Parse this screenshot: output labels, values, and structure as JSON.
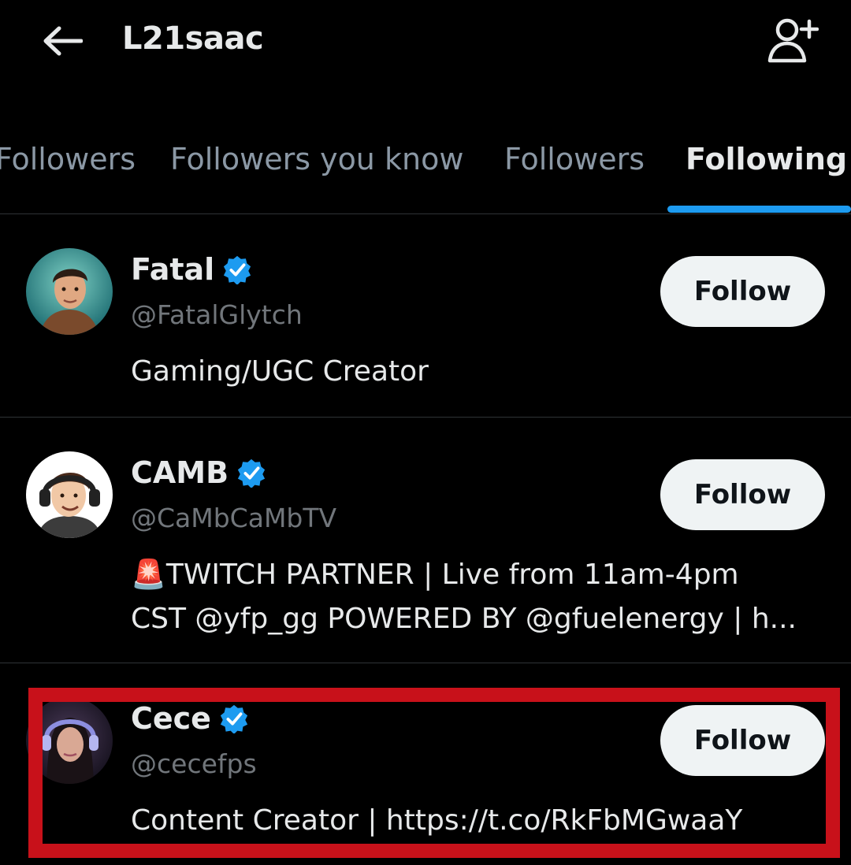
{
  "header": {
    "title": "L21saac"
  },
  "tabs": [
    {
      "label": "Followers",
      "active": false
    },
    {
      "label": "Followers you know",
      "active": false
    },
    {
      "label": "Followers",
      "active": false
    },
    {
      "label": "Following",
      "active": true
    }
  ],
  "users": [
    {
      "name": "Fatal",
      "handle": "@FatalGlytch",
      "verified": true,
      "bio": [
        "Gaming/UGC Creator"
      ],
      "follow_label": "Follow"
    },
    {
      "name": "CAMB",
      "handle": "@CaMbCaMbTV",
      "verified": true,
      "bio": [
        "🚨TWITCH PARTNER | Live from 11am-4pm",
        "CST @yfp_gg  POWERED BY @gfuelenergy | h..."
      ],
      "follow_label": "Follow"
    },
    {
      "name": "Cece",
      "handle": "@cecefps",
      "verified": true,
      "bio": [
        "Content Creator | https://t.co/RkFbMGwaaY"
      ],
      "follow_label": "Follow",
      "highlighted": true
    }
  ],
  "colors": {
    "accent": "#1d9bf0",
    "highlight": "#c8111a",
    "background": "#000000"
  }
}
